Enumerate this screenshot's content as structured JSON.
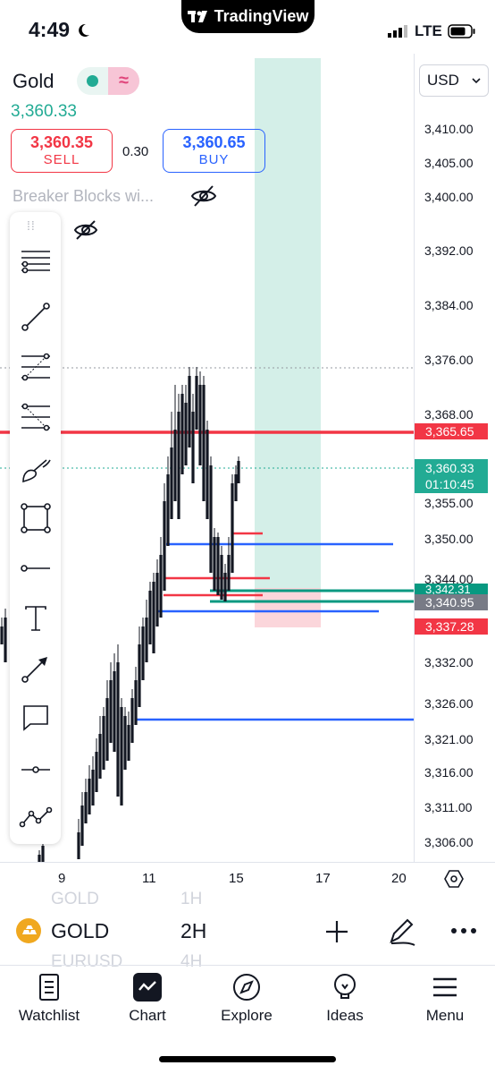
{
  "status": {
    "time": "4:49",
    "app_pill": "TradingView",
    "network": "LTE"
  },
  "symbol": {
    "name": "Gold",
    "last_price": "3,360.33"
  },
  "trade": {
    "sell_price": "3,360.35",
    "sell_label": "SELL",
    "spread": "0.30",
    "buy_price": "3,360.65",
    "buy_label": "BUY"
  },
  "indicator": {
    "label": "Breaker Blocks wi..."
  },
  "currency": "USD",
  "price_axis": [
    "3,410.00",
    "3,405.00",
    "3,400.00",
    "3,392.00",
    "3,384.00",
    "3,376.00",
    "3,368.00",
    "3,355.00",
    "3,350.00",
    "3,344.00",
    "3,332.00",
    "3,326.00",
    "3,321.00",
    "3,316.00",
    "3,311.00",
    "3,306.00"
  ],
  "price_tags": {
    "red": "3,365.65",
    "green_price": "3,360.33",
    "green_timer": "01:10:45",
    "teal": "3,342.31",
    "gray": "3,340.95",
    "pink": "3,337.28"
  },
  "colors": {
    "up": "#22ab94",
    "down": "#131722",
    "red_line": "#f23645",
    "blue_line": "#2962ff",
    "green_line": "#089981",
    "long_zone": "#d4efe8",
    "stop_zone": "#fbd6db"
  },
  "time_axis": [
    "9",
    "11",
    "15",
    "17",
    "20"
  ],
  "bottom_bar": {
    "symbol": "GOLD",
    "interval": "2H",
    "ghost_above_symbol": "GOLD",
    "ghost_above_interval": "1H",
    "ghost_below_symbol": "EURUSD",
    "ghost_below_interval": "4H"
  },
  "tabs": [
    {
      "label": "Watchlist",
      "icon": "watchlist-icon"
    },
    {
      "label": "Chart",
      "icon": "chart-icon"
    },
    {
      "label": "Explore",
      "icon": "compass-icon"
    },
    {
      "label": "Ideas",
      "icon": "lightbulb-icon"
    },
    {
      "label": "Menu",
      "icon": "hamburger-icon"
    }
  ],
  "tools": [
    "horizontal-lines-icon",
    "trend-line-icon",
    "fib-retracement-icon",
    "pitchfork-icon",
    "brush-icon",
    "rectangle-icon",
    "horizontal-ray-icon",
    "text-tool-icon",
    "arrow-icon",
    "callout-icon",
    "price-line-icon",
    "forecast-icon"
  ]
}
